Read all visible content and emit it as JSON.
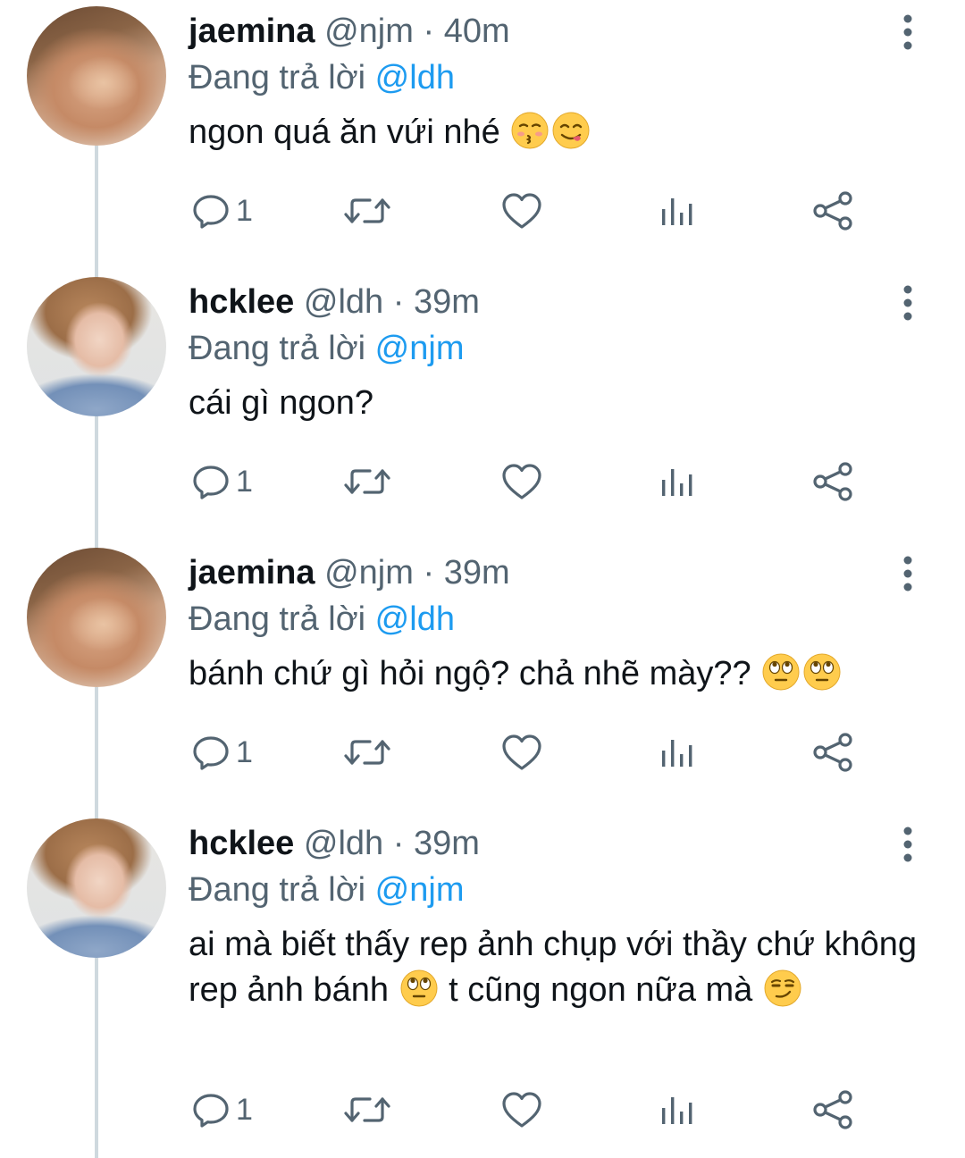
{
  "tweets": [
    {
      "display_name": "jaemina",
      "handle": "@njm",
      "separator": "·",
      "time": "40m",
      "replying_prefix": "Đang trả lời",
      "replying_to": "@ldh",
      "text_parts": [
        "ngon quá ăn vứi nhé "
      ],
      "emojis": [
        "kissing-face-icon",
        "face-savoring-food-icon"
      ],
      "reply_count": "1"
    },
    {
      "display_name": "hcklee",
      "handle": "@ldh",
      "separator": "·",
      "time": "39m",
      "replying_prefix": "Đang trả lời",
      "replying_to": "@njm",
      "text_parts": [
        "cái gì ngon?"
      ],
      "emojis": [],
      "reply_count": "1"
    },
    {
      "display_name": "jaemina",
      "handle": "@njm",
      "separator": "·",
      "time": "39m",
      "replying_prefix": "Đang trả lời",
      "replying_to": "@ldh",
      "text_parts": [
        "bánh chứ gì hỏi ngộ? chả nhẽ mày?? "
      ],
      "emojis": [
        "face-rolling-eyes-icon",
        "face-rolling-eyes-icon"
      ],
      "reply_count": "1"
    },
    {
      "display_name": "hcklee",
      "handle": "@ldh",
      "separator": "·",
      "time": "39m",
      "replying_prefix": "Đang trả lời",
      "replying_to": "@njm",
      "text_parts": [
        "ai mà biết thấy rep ảnh chụp với thầy chứ không rep ảnh bánh ",
        " t cũng ngon nữa mà "
      ],
      "emojis": [
        "face-rolling-eyes-icon",
        "smirking-face-icon"
      ],
      "reply_count": "1"
    }
  ],
  "icons": {
    "reply": "comment-bubble-icon",
    "retweet": "retweet-icon",
    "like": "heart-icon",
    "views": "analytics-bars-icon",
    "share": "share-icon",
    "more": "more-vertical-icon"
  },
  "colors": {
    "text": "#0f1419",
    "secondary": "#536471",
    "link": "#1d9bf0",
    "thread_line": "#cfd9de",
    "icon": "#536471"
  }
}
